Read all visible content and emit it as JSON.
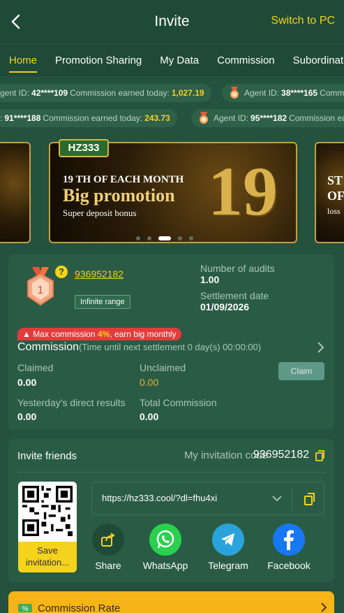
{
  "header": {
    "title": "Invite",
    "switch_label": "Switch to PC"
  },
  "tabs": [
    {
      "label": "Home",
      "active": true
    },
    {
      "label": "Promotion Sharing"
    },
    {
      "label": "My Data"
    },
    {
      "label": "Commission"
    },
    {
      "label": "Subordinate D"
    }
  ],
  "ticker": {
    "row1": [
      {
        "prefix": "Agent ID:",
        "id": "42****109",
        "text": "Commission earned today:",
        "amount": "1,027.19"
      },
      {
        "prefix": "Agent ID:",
        "id": "38****165",
        "text": "Comm"
      }
    ],
    "row2": [
      {
        "prefix": ":",
        "id": "91****188",
        "text": "Commission earned today:",
        "amount": "243.73"
      },
      {
        "prefix": "Agent ID:",
        "id": "95****182",
        "text": "Commission ea"
      }
    ]
  },
  "banner": {
    "logo": "HZ333",
    "line1": "19 TH OF EACH MONTH",
    "line2": "Big promotion",
    "line3": "Super deposit bonus",
    "big_number": "19",
    "side_text_right": [
      "ST",
      "OF",
      "loss"
    ]
  },
  "agent": {
    "level": "1",
    "user_id": "936952182",
    "range_badge": "Infinite range",
    "audits_label": "Number of audits",
    "audits_value": "1.00",
    "settlement_label": "Settlement date",
    "settlement_value": "01/09/2026"
  },
  "commission": {
    "max_prefix": "Max commission",
    "max_percent": "4%",
    "max_suffix": ", earn big monthly",
    "title": "Commission",
    "countdown": "(Time until next settlement  0 day(s) 00:00:00)",
    "claimed_label": "Claimed",
    "claimed_value": "0.00",
    "unclaimed_label": "Unclaimed",
    "unclaimed_value": "0.00",
    "claim_button": "Claim",
    "yesterday_label": "Yesterday's direct results",
    "yesterday_value": "0.00",
    "total_label": "Total Commission",
    "total_value": "0.00"
  },
  "invite": {
    "title": "Invite friends",
    "code_label": "My invitation code",
    "code": "936952182",
    "save_label": "Save invitation...",
    "link": "https://hz333.cool/?dl=fhu4xi",
    "share": [
      {
        "label": "Share",
        "icon": "share-icon"
      },
      {
        "label": "WhatsApp",
        "icon": "whatsapp-icon"
      },
      {
        "label": "Telegram",
        "icon": "telegram-icon"
      },
      {
        "label": "Facebook",
        "icon": "facebook-icon"
      }
    ]
  },
  "rate": {
    "label": "Commission Rate"
  },
  "colors": {
    "accent": "#f5d21c",
    "bg": "#24523f",
    "card": "#2a5c45",
    "danger": "#e33c3c"
  }
}
